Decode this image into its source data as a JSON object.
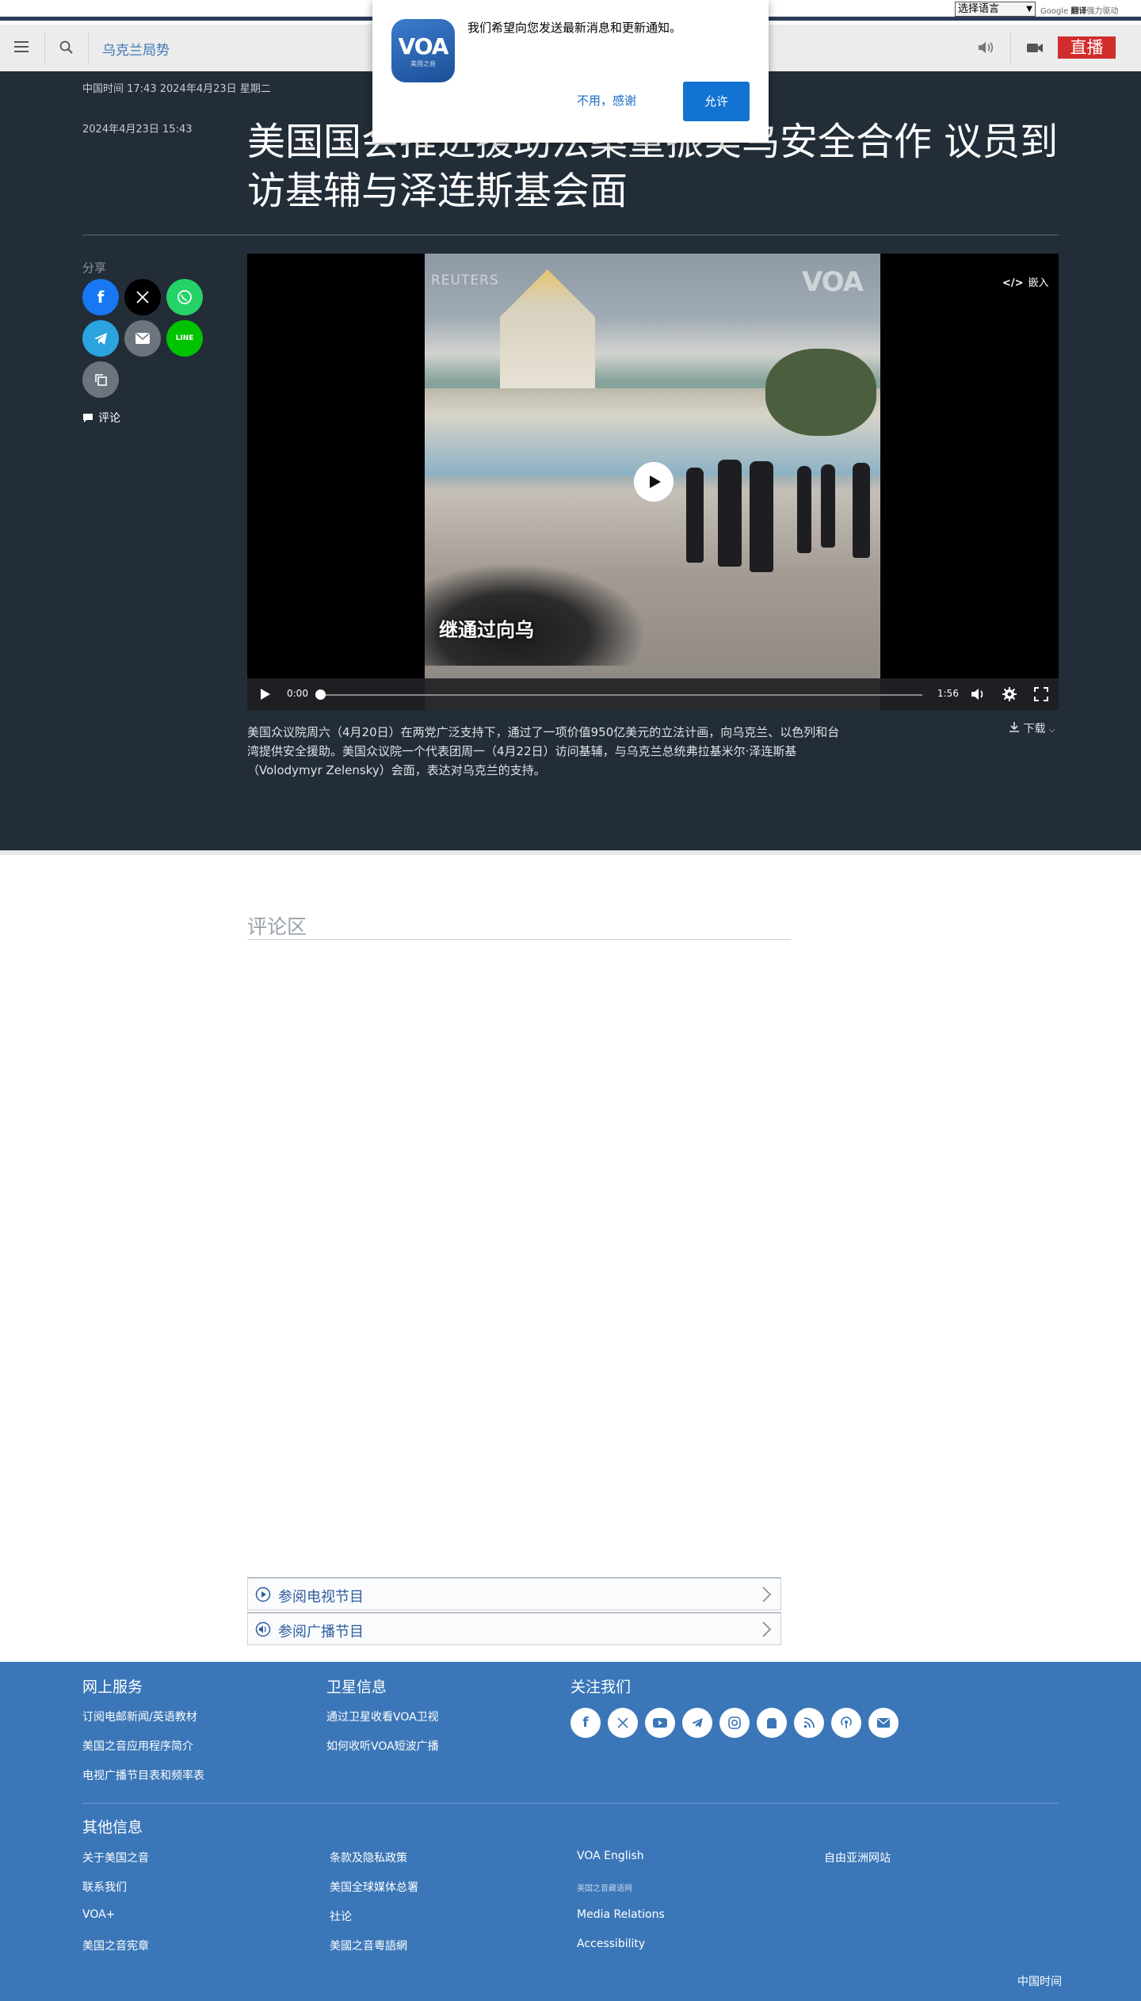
{
  "translate_bar": {
    "select_label": "选择语言",
    "powered_prefix": "Google",
    "powered_bold": "翻译",
    "powered_suffix": "强力驱动"
  },
  "nav": {
    "section": "乌克兰局势",
    "live_label": "直播"
  },
  "notification": {
    "message": "我们希望向您发送最新消息和更新通知。",
    "deny_label": "不用，感谢",
    "allow_label": "允许",
    "logo_text": "VOA",
    "logo_sub": "美国之音"
  },
  "article": {
    "china_time": "中国时间 17:43 2024年4月23日 星期二",
    "published": "2024年4月23日 15:43",
    "headline": "美国国会推进援助法案重振美乌安全合作 议员到访基辅与泽连斯基会面",
    "share_label": "分享",
    "comments_link": "评论",
    "caption": "美国众议院周六（4月20日）在两党广泛支持下，通过了一项价值950亿美元的立法计画，向乌克兰、以色列和台湾提供安全援助。美国众议院一个代表团周一（4月22日）访问基辅，与乌克兰总统弗拉基米尔·泽连斯基（Volodymyr Zelensky）会面，表达对乌克兰的支持。",
    "download_label": "下载"
  },
  "video": {
    "embed_label": "嵌入",
    "watermark_left": "REUTERS",
    "watermark_right": "VOA",
    "subtitle": "继通过向乌",
    "current_time": "0:00",
    "duration": "1:56",
    "progress": 0
  },
  "comments": {
    "title": "评论区"
  },
  "programs": {
    "tv": "参阅电视节目",
    "radio": "参阅广播节目"
  },
  "footer": {
    "col1": {
      "title": "网上服务",
      "links": [
        "订阅电邮新闻/英语教材",
        "美国之音应用程序简介",
        "电视广播节目表和频率表"
      ]
    },
    "col2": {
      "title": "卫星信息",
      "links": [
        "通过卫星收看VOA卫视",
        "如何收听VOA短波广播"
      ]
    },
    "col3": {
      "title": "关注我们"
    },
    "social_icons": [
      "facebook-icon",
      "x-icon",
      "youtube-icon",
      "telegram-icon",
      "instagram-icon",
      "store-icon",
      "rss-icon",
      "podcast-icon",
      "email-icon"
    ],
    "other_title": "其他信息",
    "other": [
      [
        "关于美国之音",
        "联系我们",
        "VOA+",
        "美国之音宪章"
      ],
      [
        "条款及隐私政策",
        "美国全球媒体总署",
        "社论",
        "美國之音粵語網"
      ],
      [
        "VOA English",
        "美国之音藏语网",
        "Media Relations",
        "Accessibility"
      ],
      [
        "自由亚洲网站"
      ]
    ],
    "time_label": "中国时间"
  },
  "colors": {
    "dark_bg": "#222d38",
    "footer_bg": "#3b77b8",
    "live_red": "#d12d2d",
    "allow_blue": "#1273d2"
  }
}
